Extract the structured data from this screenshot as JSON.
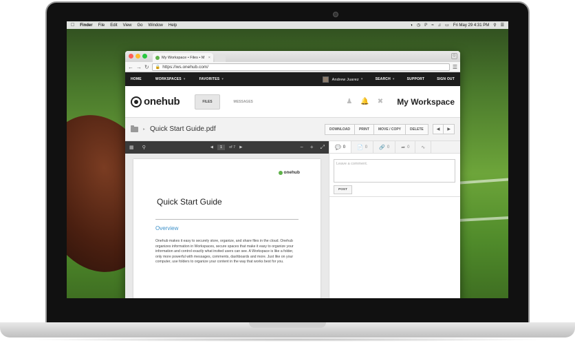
{
  "menubar": {
    "items": [
      "Finder",
      "File",
      "Edit",
      "View",
      "Go",
      "Window",
      "Help"
    ],
    "clock": "Fri May 29 4:31 PM"
  },
  "browser": {
    "tab_title": "My Workspace • Files • M",
    "url": "https://ws.onehub.com/"
  },
  "nav": {
    "home": "HOME",
    "workspaces": "WORKSPACES",
    "favorites": "FAVORITES",
    "user": "Andrew Juarez",
    "search": "SEARCH",
    "support": "SUPPORT",
    "signout": "SIGN OUT"
  },
  "header": {
    "logo": "onehub",
    "tab_files": "FILES",
    "tab_messages": "MESSAGES",
    "workspace_title": "My Workspace"
  },
  "file": {
    "title": "Quick Start Guide.pdf",
    "actions": [
      "DOWNLOAD",
      "PRINT",
      "MOVE / COPY",
      "DELETE"
    ]
  },
  "viewer": {
    "page": "1",
    "of": "of 7"
  },
  "document": {
    "logo": "onehub",
    "title": "Quick Start Guide",
    "heading": "Overview",
    "paragraph": "Onehub makes it easy to securely store, organize, and share files in the cloud. Onehub organizes information in Workspaces, secure spaces that make it easy to organize your information and control exactly what invited users can see. A Workspace is like a folder, only more powerful with messages, comments, dashboards and more. Just like on your computer, use folders to organize your content in the way that works best for you."
  },
  "panel": {
    "tabs": [
      {
        "icon": "comment-icon",
        "count": "0"
      },
      {
        "icon": "document-icon",
        "count": "0"
      },
      {
        "icon": "link-icon",
        "count": "0"
      },
      {
        "icon": "share-icon",
        "count": "0"
      },
      {
        "icon": "activity-icon",
        "count": ""
      }
    ],
    "placeholder": "Leave a comment.",
    "post": "POST"
  },
  "colors": {
    "nav_bg": "#1d1d1d",
    "accent_link": "#3a8fc8",
    "logo_green": "#5fb14a"
  }
}
